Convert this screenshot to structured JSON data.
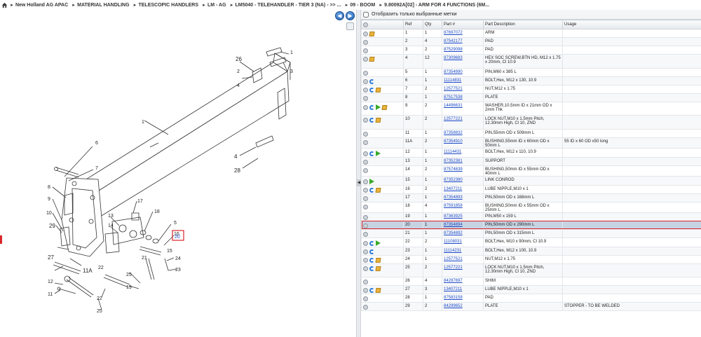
{
  "breadcrumb": {
    "items": [
      "New Holland AG APAC",
      "MATERIAL HANDLING",
      "TELESCOPIC HANDLERS",
      "LM - AG",
      "LM5040 - TELEHANDLER - TIER 3 (NA) - >> ...",
      "09 - BOOM",
      "9.80092A[02] - ARM FOR 4 FUNCTIONS (6M..."
    ]
  },
  "diagram": {
    "callouts": {
      "c26": "26",
      "c1a": "1",
      "c2": "2",
      "c4a": "4",
      "c3": "3",
      "c1": "1",
      "c4b": "4",
      "c28": "28",
      "c6": "6",
      "c7": "7",
      "c8": "8",
      "c9": "9",
      "c10": "10",
      "c29": "29",
      "c27": "27",
      "c11a": "11A",
      "c12": "12",
      "c11": "11",
      "c17": "17",
      "c13": "13",
      "c14": "14",
      "c18": "18",
      "c5": "5",
      "c16": "16",
      "c15": "15",
      "c20": "20",
      "c24": "24",
      "c21": "21",
      "c22": "22",
      "c25": "25",
      "c19": "19",
      "c23": "23",
      "c25b": "25",
      "c22b": "22"
    }
  },
  "table": {
    "filter_label": "Отобразить только выбранные метки",
    "columns": [
      "",
      "Ref",
      "Qty",
      "Part #",
      "Part Description",
      "Usage"
    ],
    "rows": [
      {
        "icons": [
          "cube"
        ],
        "ref": "1",
        "qty": "1",
        "part": "87697072",
        "desc": "ARM",
        "usage": ""
      },
      {
        "icons": [],
        "ref": "2",
        "qty": "4",
        "part": "87542177",
        "desc": "PAD",
        "usage": ""
      },
      {
        "icons": [],
        "ref": "3",
        "qty": "2",
        "part": "87529098",
        "desc": "PAD",
        "usage": ""
      },
      {
        "icons": [
          "cube"
        ],
        "ref": "4",
        "qty": "12",
        "part": "87309683",
        "desc": "HEX SOC SCREW,BTN HD, M12 x 1.75 x 20mm, Cl 10.9",
        "usage": ""
      },
      {
        "icons": [],
        "ref": "5",
        "qty": "1",
        "part": "87354890",
        "desc": "PIN,M60 x 385 L",
        "usage": ""
      },
      {
        "icons": [
          "rot"
        ],
        "ref": "6",
        "qty": "1",
        "part": "11114831",
        "desc": "BOLT,Hex, M12 x 130, 10.9",
        "usage": ""
      },
      {
        "icons": [
          "rot",
          "cube"
        ],
        "ref": "7",
        "qty": "2",
        "part": "12577521",
        "desc": "NUT,M12 x 1.75",
        "usage": ""
      },
      {
        "icons": [],
        "ref": "8",
        "qty": "1",
        "part": "87517538",
        "desc": "PLATE",
        "usage": ""
      },
      {
        "icons": [
          "rot",
          "fwd",
          "cube"
        ],
        "ref": "9",
        "qty": "2",
        "part": "14496631",
        "desc": "WASHER,10.5mm ID x 21mm OD x 2mm Thk",
        "usage": ""
      },
      {
        "icons": [
          "rot",
          "cube"
        ],
        "ref": "10",
        "qty": "2",
        "part": "12577221",
        "desc": "LOCK NUT,M10 x 1.5mm Pitch, 12.30mm High, Cl 10, ZND",
        "usage": ""
      },
      {
        "icons": [],
        "ref": "11",
        "qty": "1",
        "part": "87358832",
        "desc": "PIN,55mm OD x 509mm L",
        "usage": ""
      },
      {
        "icons": [],
        "ref": "11A",
        "qty": "2",
        "part": "87354910",
        "desc": "BUSHING,55mm ID x 60mm OD x 50mm L",
        "usage": "55 ID x 60 OD x50 long"
      },
      {
        "icons": [
          "rot",
          "fwd"
        ],
        "ref": "12",
        "qty": "1",
        "part": "11114431",
        "desc": "BOLT,Hex, M12 x 110, 10.9",
        "usage": ""
      },
      {
        "icons": [],
        "ref": "13",
        "qty": "1",
        "part": "87352381",
        "desc": "SUPPORT",
        "usage": ""
      },
      {
        "icons": [],
        "ref": "14",
        "qty": "2",
        "part": "87574639",
        "desc": "BUSHING,50mm ID x 55mm OD x 40mm L",
        "usage": ""
      },
      {
        "icons": [
          "fwd"
        ],
        "ref": "15",
        "qty": "1",
        "part": "87352380",
        "desc": "LINK CONROD",
        "usage": ""
      },
      {
        "icons": [
          "rot",
          "cube"
        ],
        "ref": "16",
        "qty": "2",
        "part": "13407211",
        "desc": "LUBE NIPPLE,M10 x 1",
        "usage": ""
      },
      {
        "icons": [],
        "ref": "17",
        "qty": "1",
        "part": "87354893",
        "desc": "PIN,50mm OD x 168mm L",
        "usage": ""
      },
      {
        "icons": [],
        "ref": "18",
        "qty": "4",
        "part": "87591858",
        "desc": "BUSHING,50mm ID x 55mm OD x 25mm L",
        "usage": ""
      },
      {
        "icons": [],
        "ref": "19",
        "qty": "1",
        "part": "87363925",
        "desc": "PIN,M50 x 159 L",
        "usage": ""
      },
      {
        "icons": [],
        "ref": "20",
        "qty": "1",
        "part": "87354894",
        "desc": "PIN,50mm OD x 290mm L",
        "usage": "",
        "selected": true
      },
      {
        "icons": [],
        "ref": "21",
        "qty": "1",
        "part": "87354892",
        "desc": "PIN,50mm OD x 315mm L",
        "usage": ""
      },
      {
        "icons": [
          "rot",
          "fwd"
        ],
        "ref": "22",
        "qty": "2",
        "part": "11108031",
        "desc": "BOLT,Hex, M10 x 90mm, Cl 10.9",
        "usage": ""
      },
      {
        "icons": [
          "rot"
        ],
        "ref": "23",
        "qty": "1",
        "part": "11114231",
        "desc": "BOLT,Hex, M12 x 100, 10.9",
        "usage": ""
      },
      {
        "icons": [
          "rot",
          "cube"
        ],
        "ref": "24",
        "qty": "1",
        "part": "12577521",
        "desc": "NUT,M12 x 1.75",
        "usage": ""
      },
      {
        "icons": [
          "rot",
          "cube"
        ],
        "ref": "25",
        "qty": "2",
        "part": "12577221",
        "desc": "LOCK NUT,M10 x 1.5mm Pitch, 12.30mm High, Cl 10, ZND",
        "usage": ""
      },
      {
        "icons": [],
        "ref": "26",
        "qty": "4",
        "part": "84287697",
        "desc": "SHIM",
        "usage": ""
      },
      {
        "icons": [
          "rot",
          "cube"
        ],
        "ref": "27",
        "qty": "3",
        "part": "13407211",
        "desc": "LUBE NIPPLE,M10 x 1",
        "usage": ""
      },
      {
        "icons": [],
        "ref": "28",
        "qty": "1",
        "part": "87583158",
        "desc": "PAD",
        "usage": ""
      },
      {
        "icons": [],
        "ref": "29",
        "qty": "2",
        "part": "84299652",
        "desc": "PLATE",
        "usage": "STOPPER - TO BE WELDED"
      }
    ]
  },
  "colors": {
    "accent": "#1f5fb3",
    "selection": "#c6d3e2",
    "highlight_border": "#d9262b",
    "link": "#1b49c6"
  },
  "icon_names": {
    "home": "home-icon",
    "back": "arrow-left-icon",
    "forward": "arrow-right-icon",
    "gear": "gear-icon",
    "cube": "cube-icon",
    "rot": "rotate-icon",
    "fwd": "green-arrow-icon"
  }
}
